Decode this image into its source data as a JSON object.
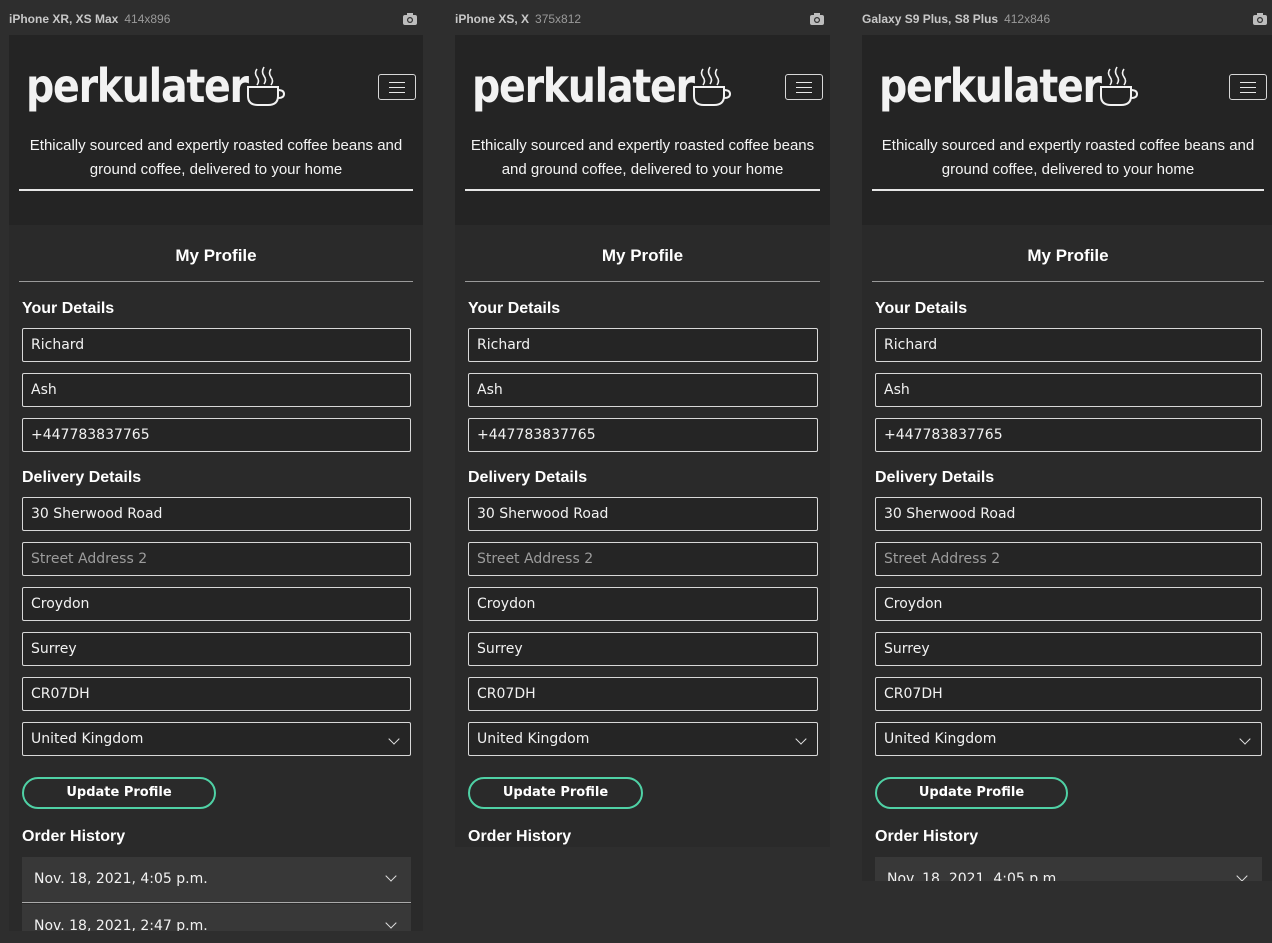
{
  "devices": [
    {
      "name": "iPhone XR, XS Max",
      "size": "414x896"
    },
    {
      "name": "iPhone XS, X",
      "size": "375x812"
    },
    {
      "name": "Galaxy S9 Plus, S8 Plus",
      "size": "412x846"
    }
  ],
  "brand": {
    "logo": "perkulater",
    "accent": "#4fd1a5"
  },
  "header": {
    "tagline": "Ethically sourced and expertly roasted coffee beans and ground coffee, delivered to your home"
  },
  "page": {
    "title": "My Profile"
  },
  "your_details": {
    "heading": "Your Details",
    "first_name": "Richard",
    "last_name": "Ash",
    "phone": "+447783837765"
  },
  "delivery": {
    "heading": "Delivery Details",
    "street1": "30 Sherwood Road",
    "street2_placeholder": "Street Address 2",
    "town": "Croydon",
    "county": "Surrey",
    "postcode": "CR07DH",
    "country": "United Kingdom"
  },
  "buttons": {
    "update": "Update Profile"
  },
  "orders": {
    "heading": "Order History",
    "items": [
      "Nov. 18, 2021, 4:05 p.m.",
      "Nov. 18, 2021, 2:47 p.m."
    ]
  }
}
